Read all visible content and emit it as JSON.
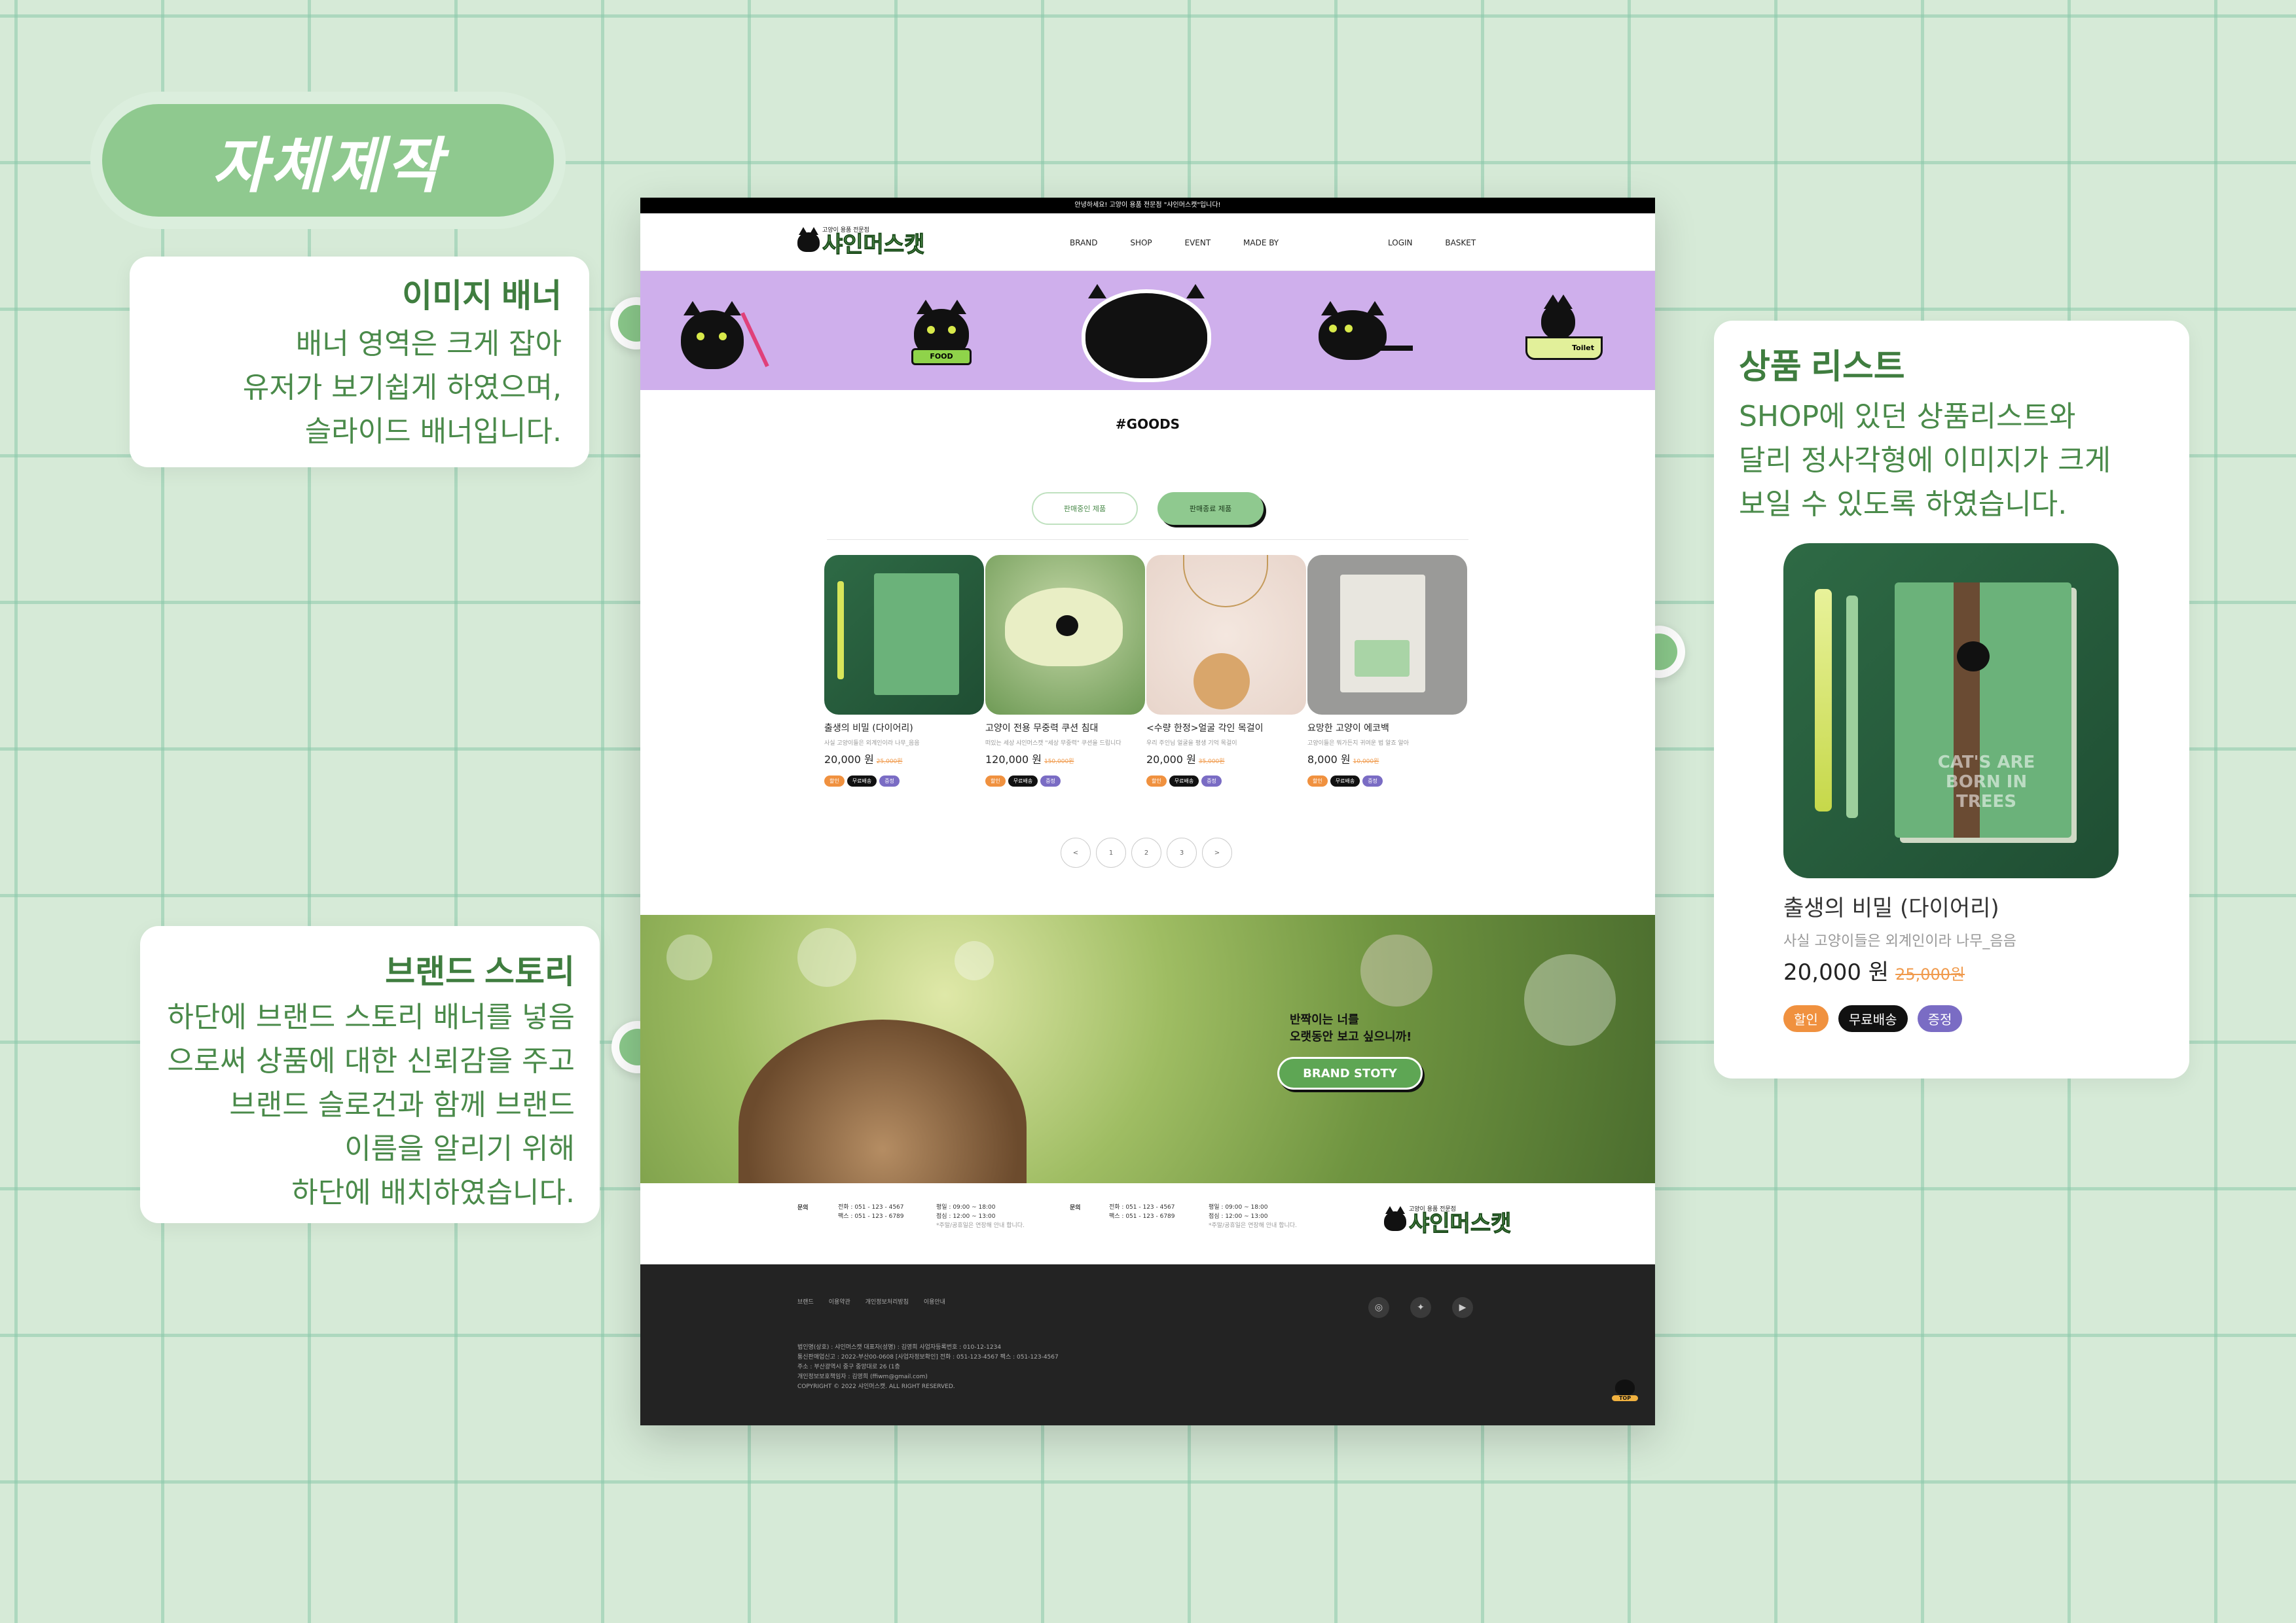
{
  "header": {
    "title": "자체제작"
  },
  "annotations": {
    "banner": {
      "title": "이미지 배너",
      "lines": [
        "배너 영역은 크게 잡아",
        "유저가 보기쉽게 하였으며,",
        "슬라이드 배너입니다."
      ]
    },
    "product_list": {
      "title": "상품 리스트",
      "lines": [
        "SHOP에 있던 상품리스트와",
        "달리 정사각형에 이미지가 크게",
        "보일 수 있도록 하였습니다."
      ]
    },
    "brand_story": {
      "title": "브랜드 스토리",
      "lines": [
        "하단에 브랜드 스토리 배너를 넣음",
        "으로써 상품에 대한 신뢰감을 주고",
        "브랜드 슬로건과 함께 브랜드",
        "이름을 알리기 위해",
        "하단에 배치하였습니다."
      ]
    }
  },
  "zoom_product": {
    "name": "출생의 비밀 (다이어리)",
    "desc": "사실 고양이들은 외계인이라 나무_음음",
    "price": "20,000 원",
    "old_price": "25,000원",
    "book_text": "CAT'S ARE BORN IN TREES",
    "tags": [
      "할인",
      "무료배송",
      "증정"
    ]
  },
  "site": {
    "topbar": "안녕하세요! 고양이 용품 전문점 \"샤인머스캣\"입니다!",
    "logo_sub": "고양이 용품 전문점",
    "logo_main": "샤인머스캣",
    "nav": [
      "BRAND",
      "SHOP",
      "EVENT",
      "MADE BY"
    ],
    "nav_right": [
      "LOGIN",
      "BASKET"
    ],
    "banner_labels": {
      "food": "FOOD",
      "toilet": "Toilet"
    },
    "goods_title": "#GOODS",
    "tab_buttons": [
      "판매중인 제품",
      "판매종료 제품"
    ],
    "products": [
      {
        "name": "출생의 비밀 (다이어리)",
        "desc": "사실 고양이들은 외계인이라 나무_음음",
        "price": "20,000 원",
        "old": "25,000원",
        "tags": [
          "할인",
          "무료배송",
          "증정"
        ]
      },
      {
        "name": "고양이 전용 무중력 쿠션 침대",
        "desc": "떠있는 세상 샤인머스캣 \"세상 무중력\" 쿠션을 드립니다",
        "price": "120,000 원",
        "old": "150,000원",
        "tags": [
          "할인",
          "무료배송",
          "증정"
        ]
      },
      {
        "name": "<수량 한정>얼굴 각인 목걸이",
        "desc": "우리 주인님 얼굴을 평생 기억 목걸이",
        "price": "20,000 원",
        "old": "35,000원",
        "tags": [
          "할인",
          "무료배송",
          "증정"
        ]
      },
      {
        "name": "요망한 고양이 에코백",
        "desc": "고양이들은 뭐가든지 귀여운 법 알죠 알아",
        "price": "8,000 원",
        "old": "10,000원",
        "tags": [
          "할인",
          "무료배송",
          "증정"
        ]
      }
    ],
    "pager": [
      "<",
      "1",
      "2",
      "3",
      ">"
    ],
    "story_line1": "반짝이는 너를",
    "story_line2": "오랫동안 보고 싶으니까!",
    "story_button": "BRAND STOTY",
    "contact": [
      {
        "label": "문의",
        "tel": "전화 : 051 - 123 - 4567",
        "fax": "팩스 : 051 - 123 - 6789",
        "hours1": "평일 : 09:00 ~ 18:00",
        "hours2": "점심 : 12:00 ~ 13:00",
        "note": "*주말/공휴일은 연장해 안내 합니다."
      },
      {
        "label": "문의",
        "tel": "전화 : 051 - 123 - 4567",
        "fax": "팩스 : 051 - 123 - 6789",
        "hours1": "평일 : 09:00 ~ 18:00",
        "hours2": "점심 : 12:00 ~ 13:00",
        "note": "*주말/공휴일은 연장해 안내 합니다."
      }
    ],
    "footer_links": [
      "브랜드",
      "이용약관",
      "개인정보처리방침",
      "이용안내"
    ],
    "footer_lines": [
      "법인명(상호) : 샤인머스캣 대표자(성명) : 김영희 사업자등록번호 : 010-12-1234",
      "통신판매업신고 : 2022-부산00-0608 [사업자정보확인] 전화 : 051-123-4567 팩스 : 051-123-4567",
      "주소 : 부산광역시 중구 중앙대로 26 (1층",
      "개인정보보호책임자 : 김영희 (ffiwm@gmail.com)",
      "COPYRIGHT © 2022 샤인머스캣. ALL RIGHT RESERVED."
    ],
    "top_label": "TOP"
  },
  "colors": {
    "accent": "#8fc98f",
    "banner": "#cfafec",
    "footer": "#232323",
    "tag_discount": "#f0913f",
    "tag_free": "#111111",
    "tag_gift": "#7a6cc4"
  }
}
